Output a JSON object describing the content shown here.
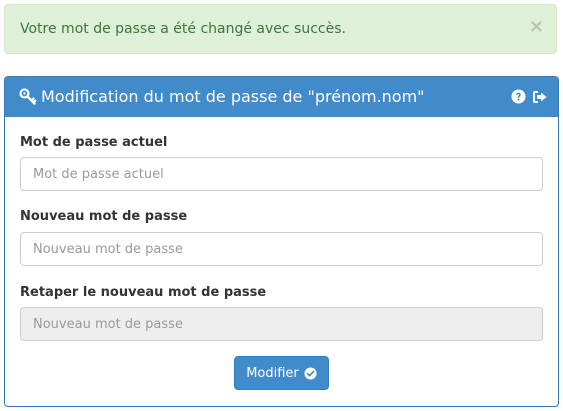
{
  "alert": {
    "message": "Votre mot de passe a été changé avec succès.",
    "close_symbol": "×"
  },
  "panel": {
    "title": "Modification du mot de passe de \"prénom.nom\"",
    "title_icon": "key-icon",
    "help_icon": "question-circle-icon",
    "logout_icon": "sign-out-icon"
  },
  "form": {
    "current_password": {
      "label": "Mot de passe actuel",
      "placeholder": "Mot de passe actuel",
      "value": ""
    },
    "new_password": {
      "label": "Nouveau mot de passe",
      "placeholder": "Nouveau mot de passe",
      "value": ""
    },
    "confirm_password": {
      "label": "Retaper le nouveau mot de passe",
      "placeholder": "Nouveau mot de passe",
      "value": "",
      "disabled": true
    },
    "submit": {
      "label": "Modifier",
      "icon": "check-circle-icon"
    }
  },
  "colors": {
    "alert_bg": "#dff0d8",
    "alert_text": "#3c763d",
    "panel_heading": "#428bca",
    "button": "#428bca"
  }
}
